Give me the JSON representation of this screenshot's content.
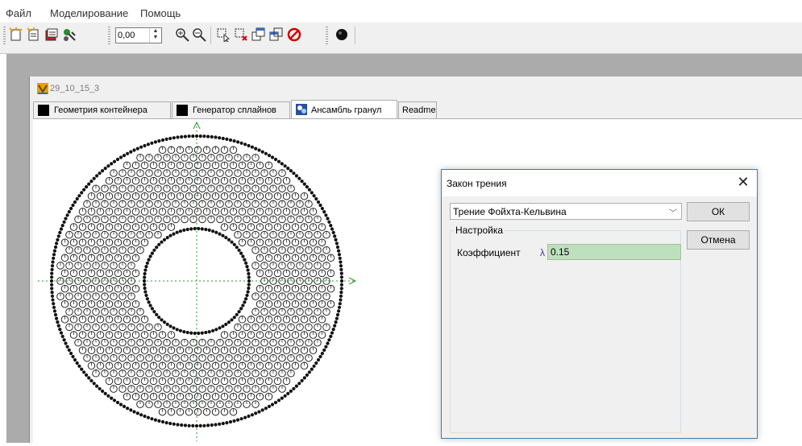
{
  "menu": {
    "file": "Файл",
    "modeling": "Моделирование",
    "help": "Помощь"
  },
  "toolbar": {
    "zoom_value": "0,00"
  },
  "window": {
    "title": "29_10_15_3"
  },
  "tabs": [
    {
      "label": "Геометрия контейнера"
    },
    {
      "label": "Генератор сплайнов"
    },
    {
      "label": "Ансамбль гранул"
    },
    {
      "label": "Readme"
    }
  ],
  "dialog": {
    "title": "Закон трения",
    "close": "✕",
    "law": "Трение Фойхта-Кельвина",
    "ok": "ОК",
    "cancel": "Отмена",
    "group_label": "Настройка",
    "coef_label": "Коэффициент",
    "lambda": "λ",
    "coef_value": "0.15"
  },
  "colors": {
    "workspace": "#ababab",
    "axis": "#2a9a2a",
    "field_bg": "#bfe0bc",
    "accent": "#3c7fb1"
  }
}
